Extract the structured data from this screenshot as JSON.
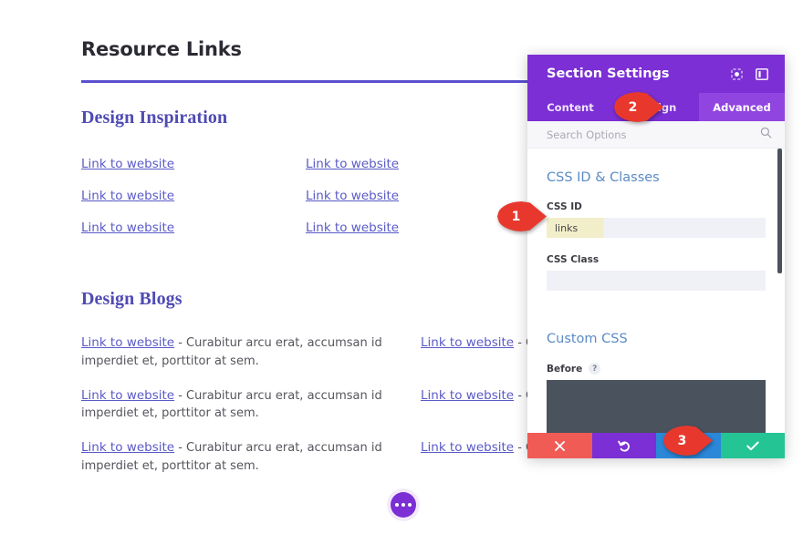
{
  "page": {
    "title": "Resource Links",
    "sections": [
      {
        "heading": "Design Inspiration",
        "rows": [
          {
            "left_link": "Link to website",
            "right_link": "Link to website"
          },
          {
            "left_link": "Link to website",
            "right_link": "Link to website"
          },
          {
            "left_link": "Link to website",
            "right_link": "Link to website"
          }
        ]
      },
      {
        "heading": "Design Blogs",
        "rows": [
          {
            "left_link": "Link to website",
            "left_desc": " - Curabitur arcu erat, accumsan id imperdiet et, porttitor at sem.",
            "right_link": "Link to website",
            "right_desc": " - Curabi"
          },
          {
            "left_link": "Link to website",
            "left_desc": " - Curabitur arcu erat, accumsan id imperdiet et, porttitor at sem.",
            "right_link": "Link to website",
            "right_desc": " - Curabi"
          },
          {
            "left_link": "Link to website",
            "left_desc": " - Curabitur arcu erat, accumsan id imperdiet et, porttitor at sem.",
            "right_link": "Link to website",
            "right_desc": " - Curabi"
          }
        ]
      }
    ],
    "fab_icon": "ellipsis-icon"
  },
  "panel": {
    "title": "Section Settings",
    "header_icons": [
      {
        "name": "expand-icon"
      },
      {
        "name": "layout-panel-icon"
      }
    ],
    "tabs": [
      {
        "label": "Content",
        "active": false
      },
      {
        "label": "Design",
        "active": false
      },
      {
        "label": "Advanced",
        "active": true
      }
    ],
    "search": {
      "placeholder": "Search Options",
      "value": "",
      "icon": "search-icon"
    },
    "groups": [
      {
        "title": "CSS ID & Classes",
        "fields": [
          {
            "label": "CSS ID",
            "value": "links",
            "placeholder": ""
          },
          {
            "label": "CSS Class",
            "value": "",
            "placeholder": ""
          }
        ]
      },
      {
        "title": "Custom CSS",
        "fields": [
          {
            "label": "Before",
            "help": "?",
            "value": ""
          }
        ]
      }
    ],
    "footer": [
      {
        "name": "cancel-button",
        "icon": "close-icon",
        "color": "#f05b55"
      },
      {
        "name": "undo-button",
        "icon": "undo-icon",
        "color": "#7b2fd4"
      },
      {
        "name": "redo-button",
        "icon": "redo-icon",
        "color": "#2b87d8"
      },
      {
        "name": "save-button",
        "icon": "check-icon",
        "color": "#25c495"
      }
    ]
  },
  "markers": [
    {
      "number": "1",
      "target": "css-id-field"
    },
    {
      "number": "2",
      "target": "advanced-tab"
    },
    {
      "number": "3",
      "target": "save-button"
    }
  ],
  "colors": {
    "brand_purple": "#7b2fd4",
    "tab_active": "#9145e0",
    "link": "#5a5ac8",
    "heading": "#4f4bb3",
    "marker_red": "#e8382d",
    "save_green": "#25c495",
    "field_highlight": "#f2eec9"
  }
}
